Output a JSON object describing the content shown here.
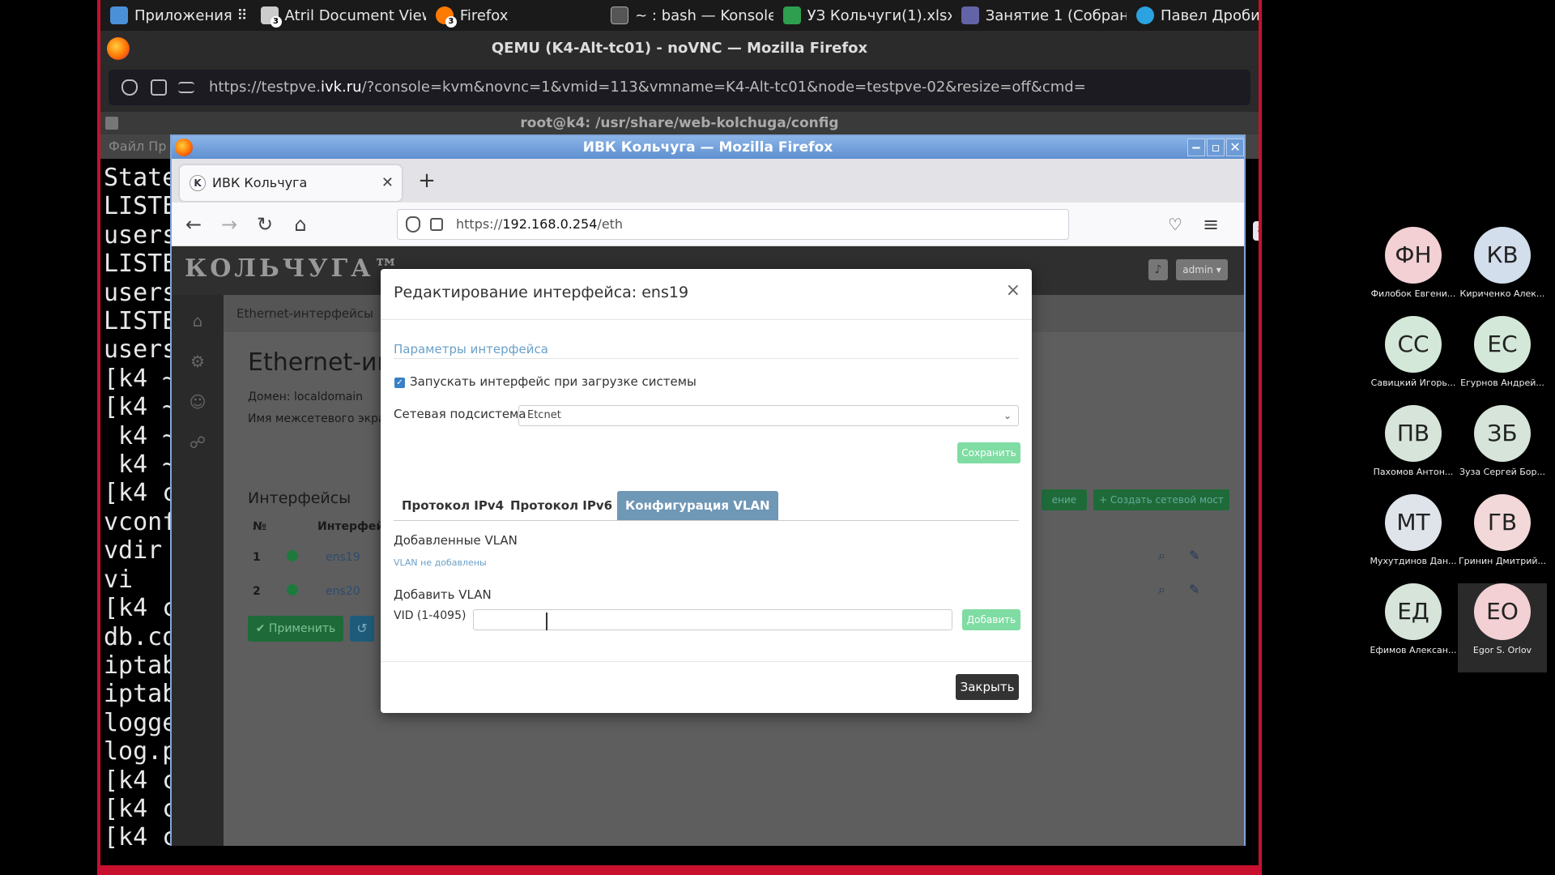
{
  "taskbar": {
    "items": [
      {
        "label": "Приложения ⠿",
        "icon": "apps-icon",
        "color": "#4a90d9"
      },
      {
        "label": "Atril Document Viewer",
        "icon": "document-viewer-icon",
        "color": "#cccccc",
        "badge": "3"
      },
      {
        "label": "Firefox",
        "icon": "firefox-icon",
        "color": "#ff7a00",
        "badge": "3"
      },
      {
        "label": "~ : bash — Konsole",
        "icon": "terminal-icon",
        "color": "#555555"
      },
      {
        "label": "УЗ Кольчуги(1).xlsx - ...",
        "icon": "spreadsheet-icon",
        "color": "#2e9e4f"
      },
      {
        "label": "Занятие 1 (Собрание)...",
        "icon": "meeting-icon",
        "color": "#6264a7"
      },
      {
        "label": "Павел Дробинц",
        "icon": "telegram-icon",
        "color": "#2aa3e0"
      }
    ]
  },
  "outer_browser": {
    "title": "QEMU (K4-Alt-tc01) - noVNC — Mozilla Firefox",
    "url_prefix": "https://testpve.",
    "url_domain": "ivk.ru",
    "url_rest": "/?console=kvm&novnc=1&vmid=113&vmname=K4-Alt-tc01&node=testpve-02&resize=off&cmd="
  },
  "konsole": {
    "title": "root@k4: /usr/share/web-kolchuga/config",
    "menu": "Файл   Пр",
    "lines": [
      "State",
      "LISTE",
      "users",
      "LISTE",
      "users",
      "LISTE",
      "users",
      "[k4 ~",
      "[k4 ~",
      " k4 ~",
      " k4 ~",
      "[k4 c",
      "vconf",
      "vdir",
      "vi",
      "[k4 c",
      "db.co",
      "iptab",
      "iptab",
      "logge",
      "log.p",
      "[k4 c",
      "[k4 c",
      "[k4 c"
    ]
  },
  "inner_browser": {
    "title": "ИВК Кольчуга — Mozilla Firefox",
    "tab_label": "ИВК Кольчуга",
    "tab_favicon": "K",
    "url_prefix": "https://",
    "url_host": "192.168.0.254",
    "url_path": "/eth",
    "zoom": "80%"
  },
  "app": {
    "logo": "КОЛЬЧУГА™",
    "admin_label": "admin ▾",
    "breadcrumb": "Ethernet-интерфейсы",
    "page_title": "Ethernet-ин",
    "domain_line": "Домен: localdomain",
    "firewall_line": "Имя межсетевого экра",
    "interfaces_head": "Интерфейсы",
    "col_num": "№",
    "col_iface": "Интерфей",
    "rows": [
      {
        "num": "1",
        "name": "ens19"
      },
      {
        "num": "2",
        "name": "ens20"
      }
    ],
    "apply_label": "✔ Применить",
    "create_bridge_label": "+ Создать сетевой мост",
    "partial_btn_label": "ение"
  },
  "modal": {
    "title": "Редактирование интерфейса: ens19",
    "section": "Параметры интерфейса",
    "autostart_label": "Запускать интерфейс при загрузке системы",
    "subsystem_label": "Сетевая подсистема",
    "subsystem_value": "Etcnet",
    "save_label": "Сохранить",
    "tabs": [
      "Протокол IPv4",
      "Протокол IPv6",
      "Конфигурация VLAN"
    ],
    "added_vlan_head": "Добавленные VLAN",
    "no_vlan_text": "VLAN не добавлены",
    "add_vlan_head": "Добавить VLAN",
    "vid_label": "VID (1-4095)",
    "vid_value": "",
    "add_label": "Добавить",
    "close_label": "Закрыть"
  },
  "participants": [
    {
      "initials": "ФН",
      "name": "Филобок Евгени...",
      "color": "#f2d0d3"
    },
    {
      "initials": "КВ",
      "name": "Кириченко Алек...",
      "color": "#d3deec"
    },
    {
      "initials": "СС",
      "name": "Савицкий Игорь...",
      "color": "#d3e8d8"
    },
    {
      "initials": "ЕС",
      "name": "Егурнов Андрей...",
      "color": "#d3e8d8"
    },
    {
      "initials": "ПВ",
      "name": "Пахомов Антон...",
      "color": "#d6e4da"
    },
    {
      "initials": "ЗБ",
      "name": "Зуза Сергей Бор...",
      "color": "#d6e4da"
    },
    {
      "initials": "МТ",
      "name": "Мухутдинов Дан...",
      "color": "#dfe3ea"
    },
    {
      "initials": "ГВ",
      "name": "Гринин Дмитрий...",
      "color": "#f2d8d8"
    },
    {
      "initials": "ЕД",
      "name": "Ефимов Алексан...",
      "color": "#d6e4da"
    },
    {
      "initials": "ЕО",
      "name": "Egor S. Orlov",
      "color": "#f2d0d3"
    }
  ]
}
